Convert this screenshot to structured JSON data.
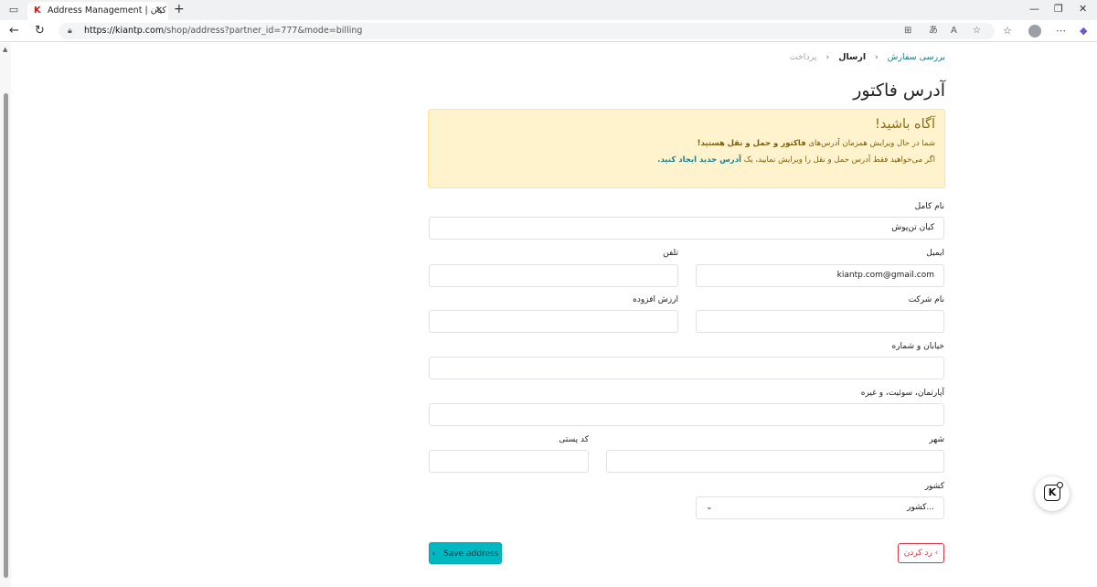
{
  "browser": {
    "tab_title": "Address Management | تن پوش کیان",
    "url_host": "https://kiantp.com",
    "url_path": "/shop/address?partner_id=777&mode=billing"
  },
  "breadcrumb": {
    "step1": "بررسی سفارش",
    "step2": "ارسال",
    "step3": "پرداخت"
  },
  "page_title": "آدرس فاکتور",
  "alert": {
    "title": "آگاه باشید!",
    "line1_prefix": "شما در حال ویرایش همزمان آدرس‌های",
    "line1_bold": "فاکتور و حمل و نقل",
    "line1_suffix": "هستید!",
    "line2_prefix": "اگر می‌خواهید فقط آدرس حمل و نقل را ویرایش نمایید، یک",
    "line2_link": "آدرس جدید ایجاد کنید."
  },
  "form": {
    "name_label": "نام کامل",
    "name_value": "کیان تن‌پوش",
    "email_label": "ایمیل",
    "email_value": "kiantp.com@gmail.com",
    "phone_label": "تلفن",
    "phone_value": "",
    "company_label": "نام شرکت",
    "company_value": "",
    "vat_label": "ارزش افزوده",
    "vat_value": "",
    "street_label": "خیابان و شماره",
    "street_value": "",
    "street2_label": "آپارتمان، سوئیت، و غیره",
    "street2_value": "",
    "city_label": "شهر",
    "city_value": "",
    "zip_label": "کد پستی",
    "zip_value": "",
    "country_label": "کشور",
    "country_value": "کشور..."
  },
  "buttons": {
    "save": "Save address",
    "cancel": "رد کردن"
  }
}
